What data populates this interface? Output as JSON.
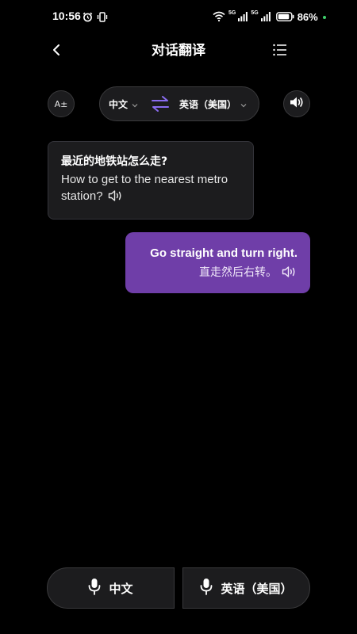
{
  "status_bar": {
    "time": "10:56",
    "battery": "86%",
    "network_label_1": "5G",
    "network_label_2": "5G"
  },
  "header": {
    "title": "对话翻译"
  },
  "language_bar": {
    "font_size_label": "A±",
    "source_language": "中文",
    "target_language": "英语（美国）"
  },
  "messages": [
    {
      "original": "最近的地铁站怎么走?",
      "translation": "How to get to the nearest metro station?"
    },
    {
      "original": "Go straight and turn right.",
      "translation": "直走然后右转。"
    }
  ],
  "bottom_bar": {
    "left_label": "中文",
    "right_label": "英语（美国）"
  },
  "colors": {
    "background": "#000000",
    "panel": "#1c1c1e",
    "accent_purple": "#6f3ea8",
    "swap_icon": "#8a6cf0",
    "charging_dot": "#3ed06b"
  },
  "icons": [
    "alarm-icon",
    "vibrate-icon",
    "wifi-icon",
    "signal-icon",
    "battery-icon",
    "back-icon",
    "list-icon",
    "font-size-icon",
    "swap-icon",
    "speaker-icon",
    "chevron-down-icon",
    "play-audio-icon",
    "microphone-icon"
  ]
}
